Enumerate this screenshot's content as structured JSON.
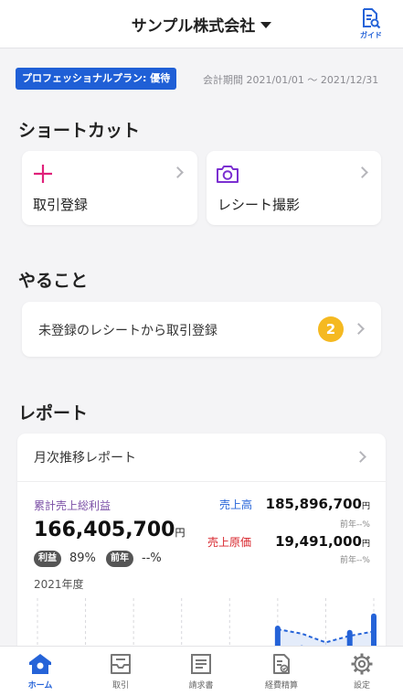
{
  "header": {
    "company_name": "サンプル株式会社",
    "guide_label": "ガイド"
  },
  "plan": {
    "badge": "プロフェッショナルプラン: 優待",
    "period": "会計期間 2021/01/01 〜 2021/12/31"
  },
  "shortcuts": {
    "title": "ショートカット",
    "items": [
      {
        "label": "取引登録",
        "icon": "plus-icon"
      },
      {
        "label": "レシート撮影",
        "icon": "camera-icon"
      }
    ]
  },
  "todo": {
    "title": "やること",
    "items": [
      {
        "label": "未登録のレシートから取引登録",
        "count": "2"
      }
    ]
  },
  "report": {
    "title": "レポート",
    "card_title": "月次推移レポート",
    "gross_profit_label": "累計売上総利益",
    "gross_profit_value": "166,405,700",
    "yen": "円",
    "profit_rate_label": "利益",
    "profit_rate_value": "89%",
    "prev_year_label": "前年",
    "prev_year_value": "--%",
    "fiscal_year": "2021年度",
    "sales_label": "売上高",
    "sales_value": "185,896,700",
    "sales_prev": "前年--%",
    "cost_label": "売上原価",
    "cost_value": "19,491,000",
    "cost_prev": "前年--%"
  },
  "chart_data": {
    "type": "bar",
    "series": [
      {
        "values": [
          0,
          0.5,
          0,
          0,
          0,
          0,
          0,
          0,
          0,
          1.3,
          5.0,
          3.2,
          0.8,
          4.6,
          6.1
        ]
      }
    ],
    "line_values": [
      null,
      null,
      null,
      null,
      null,
      null,
      null,
      null,
      null,
      null,
      3.0,
      2.6,
      1.8,
      2.4,
      2.8
    ]
  },
  "tabs": [
    {
      "label": "ホーム",
      "icon": "home-icon",
      "active": true
    },
    {
      "label": "取引",
      "icon": "inbox-icon",
      "active": false
    },
    {
      "label": "請求書",
      "icon": "invoice-icon",
      "active": false
    },
    {
      "label": "経費精算",
      "icon": "expense-icon",
      "active": false
    },
    {
      "label": "設定",
      "icon": "gear-icon",
      "active": false
    }
  ],
  "colors": {
    "accent": "#2563d8",
    "plus": "#e0217a",
    "camera": "#7b2fd1",
    "badge": "#f5b921",
    "gross_profit": "#7b4fa6",
    "sales": "#2563d8",
    "cost": "#d8252c"
  }
}
